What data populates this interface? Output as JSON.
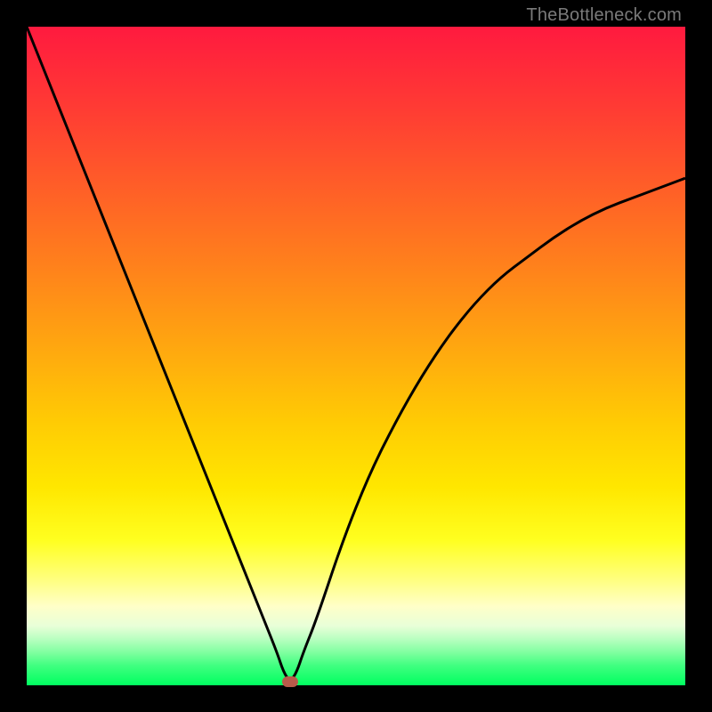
{
  "watermark": "TheBottleneck.com",
  "chart_data": {
    "type": "line",
    "title": "",
    "xlabel": "",
    "ylabel": "",
    "xlim": [
      0,
      100
    ],
    "ylim": [
      0,
      100
    ],
    "grid": false,
    "legend": false,
    "notes": "V-shaped bottleneck curve on rainbow gradient. No axis ticks or labels visible. Values estimated from pixel positions.",
    "series": [
      {
        "name": "bottleneck-curve",
        "x": [
          0,
          4,
          8,
          12,
          16,
          20,
          24,
          28,
          32,
          36,
          38,
          39,
          40,
          41,
          42,
          44,
          48,
          52,
          56,
          60,
          64,
          68,
          72,
          76,
          80,
          84,
          88,
          92,
          96,
          100
        ],
        "y": [
          100,
          90,
          80,
          70,
          60,
          50,
          40,
          30,
          20,
          10,
          5,
          2,
          0.5,
          2,
          5,
          10,
          22,
          32,
          40,
          47,
          53,
          58,
          62,
          65,
          68,
          70.5,
          72.5,
          74,
          75.5,
          77
        ]
      }
    ],
    "marker": {
      "x": 40,
      "y": 0.5,
      "color": "#b85a4a"
    },
    "colors": {
      "curve": "#000000",
      "gradient_top": "#ff1a3f",
      "gradient_bottom": "#00ff60",
      "frame": "#000000"
    }
  }
}
